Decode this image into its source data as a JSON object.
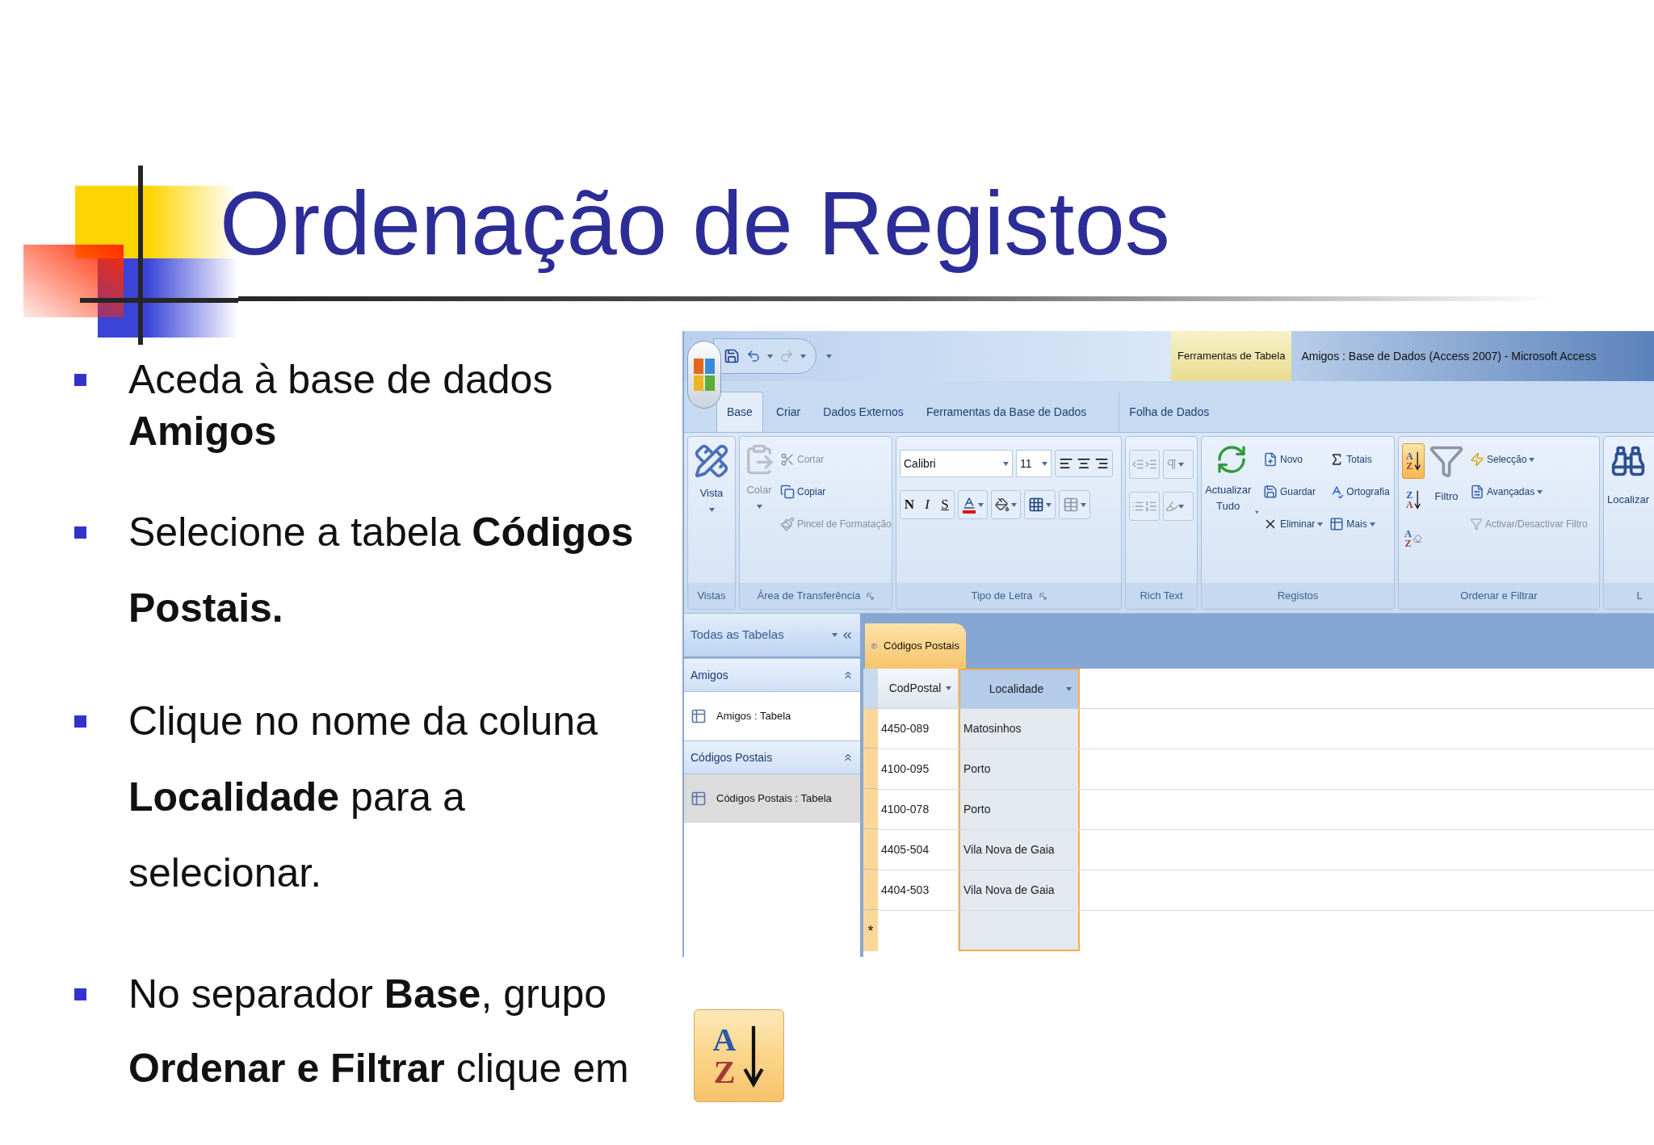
{
  "title": "Ordenação de Registos",
  "bullets": [
    "Aceda à base de dados **Amigos**",
    "Selecione a tabela **Códigos Postais.**",
    "Clique no nome da coluna **Localidade** para a selecionar.",
    "No separador **Base**, grupo **Ordenar e Filtrar** clique em"
  ],
  "sort_icon": {
    "letters": [
      "A",
      "Z"
    ]
  },
  "access": {
    "title_bar": {
      "context_label": "Ferramentas de Tabela",
      "title": "Amigos : Base de Dados (Access 2007) - Microsoft Access"
    },
    "tabs": [
      {
        "label": "Base",
        "selected": true
      },
      {
        "label": "Criar",
        "selected": false
      },
      {
        "label": "Dados Externos",
        "selected": false
      },
      {
        "label": "Ferramentas da Base de Dados",
        "selected": false
      },
      {
        "label": "Folha de Dados",
        "selected": false
      }
    ],
    "groups": [
      {
        "kind": "views",
        "label": "Vistas",
        "buttons": [
          {
            "label": "Vista",
            "disabled": false
          }
        ]
      },
      {
        "kind": "clipboard",
        "label": "Área de Transferência",
        "buttons": [
          {
            "label": "Colar",
            "disabled": true
          },
          {
            "label": "Cortar",
            "disabled": true
          },
          {
            "label": "Copiar",
            "disabled": false
          },
          {
            "label": "Pincel de Formatação",
            "disabled": true
          }
        ]
      },
      {
        "kind": "font",
        "label": "Tipo de Letra",
        "font": "Calibri",
        "size": "11",
        "styles": [
          "N",
          "I",
          "S"
        ]
      },
      {
        "kind": "rich_text",
        "label": "Rich Text"
      },
      {
        "kind": "records",
        "label": "Registos",
        "buttons": [
          {
            "label": "Actualizar Tudo"
          },
          {
            "label": "Novo"
          },
          {
            "label": "Guardar"
          },
          {
            "label": "Eliminar"
          },
          {
            "label": "Totais"
          },
          {
            "label": "Ortografia"
          },
          {
            "label": "Mais"
          }
        ]
      },
      {
        "kind": "sort_filter",
        "label": "Ordenar e Filtrar",
        "sort_buttons": [
          {
            "letters": [
              "A",
              "Z"
            ],
            "selected": true
          },
          {
            "letters": [
              "Z",
              "A"
            ],
            "selected": false
          },
          {
            "letters": [
              "A",
              "Z"
            ],
            "selected": false
          }
        ],
        "buttons": [
          {
            "label": "Filtro",
            "disabled": false
          },
          {
            "label": "Selecção",
            "disabled": false
          },
          {
            "label": "Avançadas",
            "disabled": false
          },
          {
            "label": "Activar/Desactivar Filtro",
            "disabled": true
          }
        ]
      },
      {
        "kind": "find",
        "label": "L",
        "buttons": [
          {
            "label": "Localizar"
          }
        ]
      }
    ],
    "navigation": {
      "header": "Todas as Tabelas",
      "groups": [
        {
          "label": "Amigos",
          "items": [
            {
              "label": "Amigos : Tabela",
              "selected": false
            }
          ]
        },
        {
          "label": "Códigos Postais",
          "items": [
            {
              "label": "Códigos Postais : Tabela",
              "selected": true
            }
          ]
        }
      ]
    },
    "document_tab": "Códigos Postais",
    "table": {
      "columns": [
        {
          "label": "CodPostal",
          "selected": false
        },
        {
          "label": "Localidade",
          "selected": true
        }
      ],
      "rows": [
        [
          "4450-089",
          "Matosinhos"
        ],
        [
          "4100-095",
          "Porto"
        ],
        [
          "4100-078",
          "Porto"
        ],
        [
          "4405-504",
          "Vila Nova de Gaia"
        ],
        [
          "4404-503",
          "Vila Nova de Gaia"
        ]
      ],
      "new_row_marker": "*"
    }
  }
}
